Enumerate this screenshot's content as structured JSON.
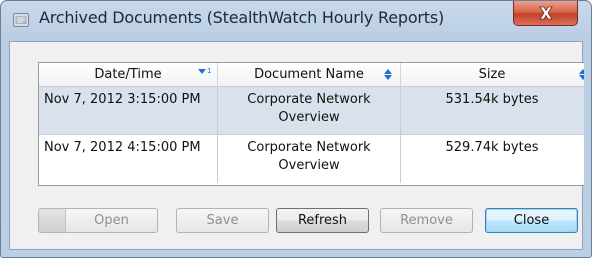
{
  "window": {
    "title": "Archived Documents  (StealthWatch Hourly Reports)",
    "close_symbol": "X"
  },
  "table": {
    "columns": [
      {
        "label": "Date/Time",
        "sort_indicator": "▼¹"
      },
      {
        "label": "Document Name",
        "sort_indicator": "◆"
      },
      {
        "label": "Size",
        "sort_indicator": "◆"
      }
    ],
    "rows": [
      {
        "datetime": "Nov 7, 2012 3:15:00 PM",
        "name": "Corporate Network Overview",
        "size": "531.54k bytes",
        "selected": true
      },
      {
        "datetime": "Nov 7, 2012 4:15:00 PM",
        "name": "Corporate Network Overview",
        "size": "529.74k bytes",
        "selected": false
      }
    ]
  },
  "buttons": {
    "open": "Open",
    "save": "Save",
    "refresh": "Refresh",
    "remove": "Remove",
    "close": "Close"
  },
  "colors": {
    "title_bar": "#c9d9ea",
    "close_button": "#d05038",
    "selected_row": "#d9e2ec",
    "default_button": "#bee6fd"
  }
}
